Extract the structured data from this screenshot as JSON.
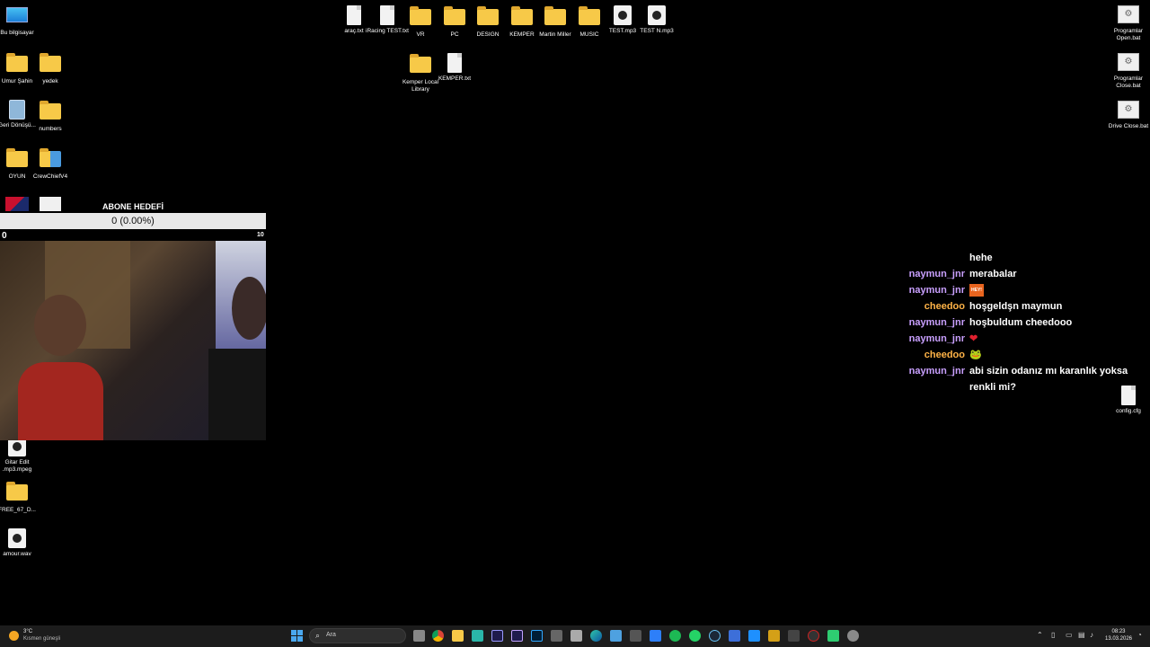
{
  "desktop": {
    "left_icons": [
      {
        "label": "Bu bilgisayar",
        "kind": "monitor"
      },
      {
        "label": "Umur Şahin",
        "kind": "folder"
      },
      {
        "label": "yedek",
        "kind": "folder"
      },
      {
        "label": "Geri Dönüşü...",
        "kind": "recycle"
      },
      {
        "label": "numbers",
        "kind": "folder"
      },
      {
        "label": "OYUN",
        "kind": "folder"
      },
      {
        "label": "CrewChiefV4",
        "kind": "app"
      }
    ],
    "top_icons": [
      {
        "label": "araç.txt",
        "kind": "doc"
      },
      {
        "label": "iRacing TEST.txt",
        "kind": "doc"
      },
      {
        "label": "VR",
        "kind": "folder"
      },
      {
        "label": "PC",
        "kind": "folder"
      },
      {
        "label": "DESIGN",
        "kind": "folder"
      },
      {
        "label": "KEMPER",
        "kind": "folder"
      },
      {
        "label": "Martin Miller",
        "kind": "folder"
      },
      {
        "label": "MUSIC",
        "kind": "folder"
      },
      {
        "label": "TEST.mp3",
        "kind": "media"
      },
      {
        "label": "TEST N.mp3",
        "kind": "media"
      },
      {
        "label": "Kemper Local Library",
        "kind": "folder"
      },
      {
        "label": "KEMPER.txt",
        "kind": "doc"
      }
    ],
    "right_icons": [
      {
        "label": "Programlar Open.bat",
        "kind": "bat"
      },
      {
        "label": "Programlar Close.bat",
        "kind": "bat"
      },
      {
        "label": "Drive Close.bat",
        "kind": "bat"
      },
      {
        "label": "config.cfg",
        "kind": "doc"
      }
    ],
    "bottom_left_icons": [
      {
        "label": "Gitar Edit .mp3.mpeg",
        "kind": "media"
      },
      {
        "label": "FREE_67_D...",
        "kind": "folder"
      },
      {
        "label": "amour.wav",
        "kind": "media"
      }
    ]
  },
  "sub_goal": {
    "title": "ABONE HEDEFİ",
    "progress_text": "0 (0.00%)",
    "progress_fraction": 0,
    "min": "0",
    "max": "10",
    "fill_color": "#57c84d"
  },
  "chat": {
    "messages": [
      {
        "user": "",
        "text": "hehe",
        "color": "#ffffff"
      },
      {
        "user": "naymun_jnr",
        "text": "merabalar",
        "color": "#c9a0ff"
      },
      {
        "user": "naymun_jnr",
        "text": "HEY emote",
        "emote": true,
        "color": "#c9a0ff"
      },
      {
        "user": "cheedoo",
        "text": "hoşgeldşn maymun",
        "color": "#ffb347"
      },
      {
        "user": "naymun_jnr",
        "text": "hoşbuldum cheedooo",
        "color": "#c9a0ff"
      },
      {
        "user": "naymun_jnr",
        "text": "❤",
        "color": "#c9a0ff"
      },
      {
        "user": "cheedoo",
        "text": "🐸",
        "color": "#ffb347"
      },
      {
        "user": "naymun_jnr",
        "text": "abi sizin odanız mı karanlık yoksa renkli mi?",
        "color": "#c9a0ff"
      }
    ]
  },
  "taskbar": {
    "weather_temp": "3°C",
    "weather_desc": "Kısmen güneşli",
    "search_placeholder": "Ara",
    "search_icon": "search-icon",
    "time": "08:23",
    "date": "13.03.2026"
  }
}
